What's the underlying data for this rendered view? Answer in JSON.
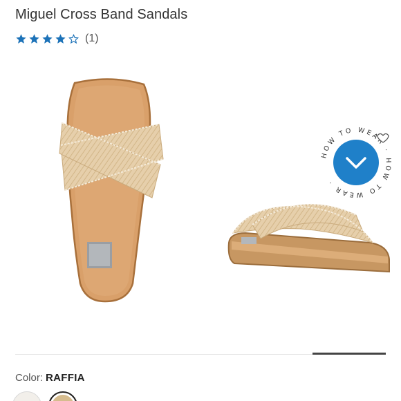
{
  "product": {
    "title": "Miguel Cross Band Sandals",
    "rating_value": 4,
    "rating_max": 5,
    "review_count": "(1)"
  },
  "how_to_wear": {
    "label": "HOW TO WEAR",
    "icon": "heart-icon",
    "button_icon": "chevron-down-icon",
    "accent_color": "#1f80c9"
  },
  "gallery": {
    "active_slide_fraction": 0.2,
    "images": [
      {
        "name": "sandal top view",
        "icon": "sandal-image"
      },
      {
        "name": "sandal side view",
        "icon": "sandal-image"
      }
    ]
  },
  "color": {
    "label": "Color:",
    "value": "RAFFIA"
  },
  "colors": {
    "star": "#1c72b8",
    "star_empty_stroke": "#1c72b8",
    "footbed": "#d9a06a",
    "strap": "#e8d3b3"
  }
}
